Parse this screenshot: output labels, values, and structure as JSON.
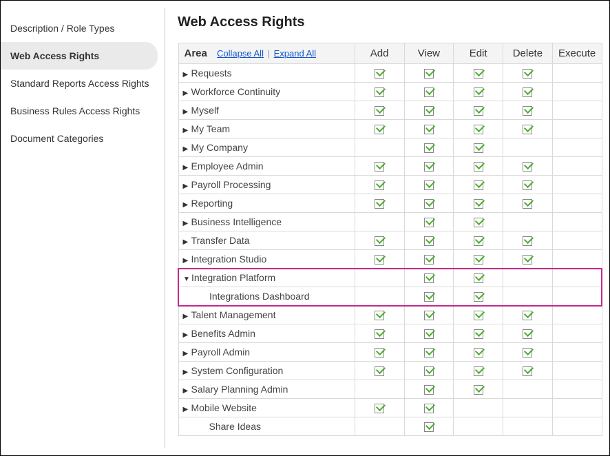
{
  "sidebar": {
    "items": [
      {
        "label": "Description / Role Types",
        "active": false
      },
      {
        "label": "Web Access Rights",
        "active": true
      },
      {
        "label": "Standard Reports Access Rights",
        "active": false
      },
      {
        "label": "Business Rules Access Rights",
        "active": false
      },
      {
        "label": "Document Categories",
        "active": false
      }
    ]
  },
  "page": {
    "title": "Web Access Rights"
  },
  "table": {
    "area_header": "Area",
    "collapse_label": "Collapse All",
    "expand_label": "Expand All",
    "columns": [
      "Add",
      "View",
      "Edit",
      "Delete",
      "Execute"
    ]
  },
  "rows": [
    {
      "label": "Requests",
      "expandable": true,
      "expanded": false,
      "indent": 0,
      "perms": [
        true,
        true,
        true,
        true,
        false
      ],
      "highlight": ""
    },
    {
      "label": "Workforce Continuity",
      "expandable": true,
      "expanded": false,
      "indent": 0,
      "perms": [
        true,
        true,
        true,
        true,
        false
      ],
      "highlight": ""
    },
    {
      "label": "Myself",
      "expandable": true,
      "expanded": false,
      "indent": 0,
      "perms": [
        true,
        true,
        true,
        true,
        false
      ],
      "highlight": ""
    },
    {
      "label": "My Team",
      "expandable": true,
      "expanded": false,
      "indent": 0,
      "perms": [
        true,
        true,
        true,
        true,
        false
      ],
      "highlight": ""
    },
    {
      "label": "My Company",
      "expandable": true,
      "expanded": false,
      "indent": 0,
      "perms": [
        false,
        true,
        true,
        false,
        false
      ],
      "highlight": ""
    },
    {
      "label": "Employee Admin",
      "expandable": true,
      "expanded": false,
      "indent": 0,
      "perms": [
        true,
        true,
        true,
        true,
        false
      ],
      "highlight": ""
    },
    {
      "label": "Payroll Processing",
      "expandable": true,
      "expanded": false,
      "indent": 0,
      "perms": [
        true,
        true,
        true,
        true,
        false
      ],
      "highlight": ""
    },
    {
      "label": "Reporting",
      "expandable": true,
      "expanded": false,
      "indent": 0,
      "perms": [
        true,
        true,
        true,
        true,
        false
      ],
      "highlight": ""
    },
    {
      "label": "Business Intelligence",
      "expandable": true,
      "expanded": false,
      "indent": 0,
      "perms": [
        false,
        true,
        true,
        false,
        false
      ],
      "highlight": ""
    },
    {
      "label": "Transfer Data",
      "expandable": true,
      "expanded": false,
      "indent": 0,
      "perms": [
        true,
        true,
        true,
        true,
        false
      ],
      "highlight": ""
    },
    {
      "label": "Integration Studio",
      "expandable": true,
      "expanded": false,
      "indent": 0,
      "perms": [
        true,
        true,
        true,
        true,
        false
      ],
      "highlight": ""
    },
    {
      "label": "Integration Platform",
      "expandable": true,
      "expanded": true,
      "indent": 0,
      "perms": [
        false,
        true,
        true,
        false,
        false
      ],
      "highlight": "top"
    },
    {
      "label": "Integrations Dashboard",
      "expandable": false,
      "expanded": false,
      "indent": 1,
      "perms": [
        false,
        true,
        true,
        false,
        false
      ],
      "highlight": "bottom"
    },
    {
      "label": "Talent Management",
      "expandable": true,
      "expanded": false,
      "indent": 0,
      "perms": [
        true,
        true,
        true,
        true,
        false
      ],
      "highlight": ""
    },
    {
      "label": "Benefits Admin",
      "expandable": true,
      "expanded": false,
      "indent": 0,
      "perms": [
        true,
        true,
        true,
        true,
        false
      ],
      "highlight": ""
    },
    {
      "label": "Payroll Admin",
      "expandable": true,
      "expanded": false,
      "indent": 0,
      "perms": [
        true,
        true,
        true,
        true,
        false
      ],
      "highlight": ""
    },
    {
      "label": "System Configuration",
      "expandable": true,
      "expanded": false,
      "indent": 0,
      "perms": [
        true,
        true,
        true,
        true,
        false
      ],
      "highlight": ""
    },
    {
      "label": "Salary Planning Admin",
      "expandable": true,
      "expanded": false,
      "indent": 0,
      "perms": [
        false,
        true,
        true,
        false,
        false
      ],
      "highlight": ""
    },
    {
      "label": "Mobile Website",
      "expandable": true,
      "expanded": false,
      "indent": 0,
      "perms": [
        true,
        true,
        false,
        false,
        false
      ],
      "highlight": ""
    },
    {
      "label": "Share Ideas",
      "expandable": false,
      "expanded": false,
      "indent": 1,
      "perms": [
        false,
        true,
        false,
        false,
        false
      ],
      "highlight": ""
    }
  ]
}
